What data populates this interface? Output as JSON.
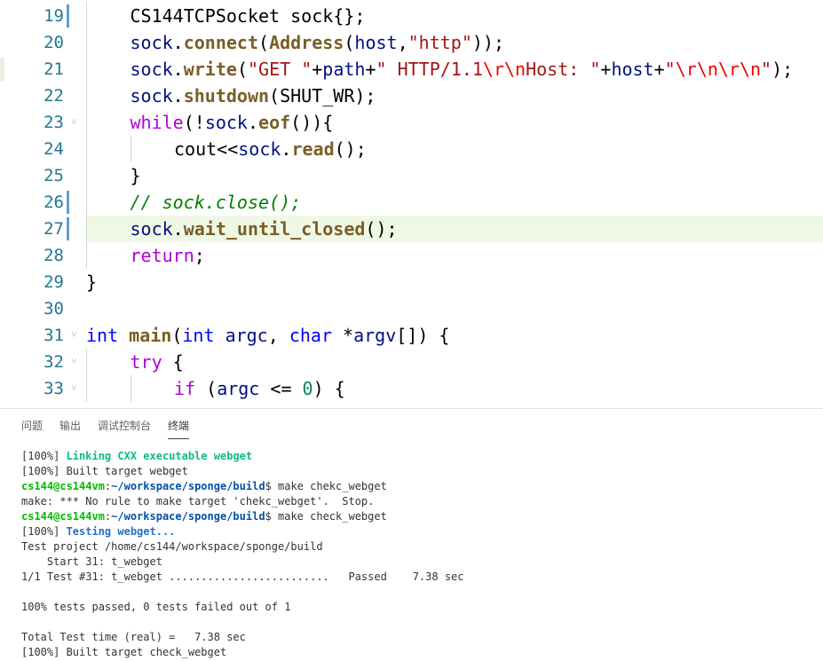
{
  "colors": {
    "line_number": "#237893",
    "change_marker": "#5f9ecf",
    "current_line_highlight": "#eef8e4",
    "keyword": "#0000ff",
    "control": "#af00db",
    "function": "#795e26",
    "string": "#a31515",
    "escape": "#ee0000",
    "variable": "#001080",
    "number": "#098658",
    "comment": "#008000",
    "term_green": "#0dbc79",
    "term_blue": "#2472c8",
    "prompt_green": "#00bc00",
    "prompt_blue": "#0451a5"
  },
  "editor": {
    "lines": [
      {
        "num": "19",
        "modified": true,
        "indent": 1,
        "tokens": [
          {
            "t": "CS144TCPSocket sock{};",
            "c": ""
          }
        ]
      },
      {
        "num": "20",
        "indent": 1,
        "tokens": [
          {
            "t": "sock",
            "c": "var"
          },
          {
            "t": ".",
            "c": ""
          },
          {
            "t": "connect",
            "c": "fn"
          },
          {
            "t": "(",
            "c": ""
          },
          {
            "t": "Address",
            "c": "fn"
          },
          {
            "t": "(",
            "c": ""
          },
          {
            "t": "host",
            "c": "var"
          },
          {
            "t": ",",
            "c": ""
          },
          {
            "t": "\"http\"",
            "c": "str"
          },
          {
            "t": "));",
            "c": ""
          }
        ]
      },
      {
        "num": "21",
        "edge": true,
        "indent": 1,
        "tokens": [
          {
            "t": "sock",
            "c": "var"
          },
          {
            "t": ".",
            "c": ""
          },
          {
            "t": "write",
            "c": "fn"
          },
          {
            "t": "(",
            "c": ""
          },
          {
            "t": "\"GET \"",
            "c": "str"
          },
          {
            "t": "+",
            "c": ""
          },
          {
            "t": "path",
            "c": "var"
          },
          {
            "t": "+",
            "c": ""
          },
          {
            "t": "\" HTTP/1.1",
            "c": "str"
          },
          {
            "t": "\\r\\n",
            "c": "esc"
          },
          {
            "t": "Host: \"",
            "c": "str"
          },
          {
            "t": "+",
            "c": ""
          },
          {
            "t": "host",
            "c": "var"
          },
          {
            "t": "+",
            "c": ""
          },
          {
            "t": "\"",
            "c": "str"
          },
          {
            "t": "\\r\\n\\r\\n",
            "c": "esc"
          },
          {
            "t": "\"",
            "c": "str"
          },
          {
            "t": ");",
            "c": ""
          }
        ]
      },
      {
        "num": "22",
        "indent": 1,
        "tokens": [
          {
            "t": "sock",
            "c": "var"
          },
          {
            "t": ".",
            "c": ""
          },
          {
            "t": "shutdown",
            "c": "fn"
          },
          {
            "t": "(SHUT_WR);",
            "c": ""
          }
        ]
      },
      {
        "num": "23",
        "fold": true,
        "indent": 1,
        "tokens": [
          {
            "t": "while",
            "c": "ctl"
          },
          {
            "t": "(!",
            "c": ""
          },
          {
            "t": "sock",
            "c": "var"
          },
          {
            "t": ".",
            "c": ""
          },
          {
            "t": "eof",
            "c": "fn"
          },
          {
            "t": "()){",
            "c": ""
          }
        ]
      },
      {
        "num": "24",
        "indent": 2,
        "tokens": [
          {
            "t": "cout<<",
            "c": ""
          },
          {
            "t": "sock",
            "c": "var"
          },
          {
            "t": ".",
            "c": ""
          },
          {
            "t": "read",
            "c": "fn"
          },
          {
            "t": "();",
            "c": ""
          }
        ]
      },
      {
        "num": "25",
        "indent": 1,
        "tokens": [
          {
            "t": "}",
            "c": ""
          }
        ]
      },
      {
        "num": "26",
        "modified": true,
        "indent": 1,
        "tokens": [
          {
            "t": "// sock.close();",
            "c": "com"
          }
        ]
      },
      {
        "num": "27",
        "modified": true,
        "highlight": true,
        "indent": 1,
        "tokens": [
          {
            "t": "sock",
            "c": "var"
          },
          {
            "t": ".",
            "c": ""
          },
          {
            "t": "wait_until_closed",
            "c": "fn"
          },
          {
            "t": "();",
            "c": ""
          }
        ]
      },
      {
        "num": "28",
        "indent": 1,
        "tokens": [
          {
            "t": "return",
            "c": "ctl"
          },
          {
            "t": ";",
            "c": ""
          }
        ]
      },
      {
        "num": "29",
        "indent": 0,
        "tokens": [
          {
            "t": "}",
            "c": ""
          }
        ]
      },
      {
        "num": "30",
        "indent": 0,
        "tokens": []
      },
      {
        "num": "31",
        "fold": true,
        "indent": 0,
        "tokens": [
          {
            "t": "int",
            "c": "kw"
          },
          {
            "t": " ",
            "c": ""
          },
          {
            "t": "main",
            "c": "fn"
          },
          {
            "t": "(",
            "c": ""
          },
          {
            "t": "int",
            "c": "kw"
          },
          {
            "t": " ",
            "c": ""
          },
          {
            "t": "argc",
            "c": "var"
          },
          {
            "t": ", ",
            "c": ""
          },
          {
            "t": "char",
            "c": "kw"
          },
          {
            "t": " *",
            "c": ""
          },
          {
            "t": "argv",
            "c": "var"
          },
          {
            "t": "[]) {",
            "c": ""
          }
        ]
      },
      {
        "num": "32",
        "fold": true,
        "indent": 1,
        "tokens": [
          {
            "t": "try",
            "c": "ctl"
          },
          {
            "t": " {",
            "c": ""
          }
        ]
      },
      {
        "num": "33",
        "fold": true,
        "indent": 2,
        "tokens": [
          {
            "t": "if",
            "c": "ctl"
          },
          {
            "t": " (",
            "c": ""
          },
          {
            "t": "argc",
            "c": "var"
          },
          {
            "t": " <= ",
            "c": ""
          },
          {
            "t": "0",
            "c": "num"
          },
          {
            "t": ") {",
            "c": ""
          }
        ]
      }
    ]
  },
  "panel": {
    "tabs": [
      {
        "label": "问题",
        "active": false
      },
      {
        "label": "输出",
        "active": false
      },
      {
        "label": "调试控制台",
        "active": false
      },
      {
        "label": "终端",
        "active": true
      }
    ],
    "terminal_lines": [
      [
        {
          "t": "[100%] ",
          "c": ""
        },
        {
          "t": "Linking CXX executable webget",
          "c": "green"
        }
      ],
      [
        {
          "t": "[100%] Built target webget",
          "c": ""
        }
      ],
      [
        {
          "t": "cs144@cs144vm",
          "c": "pgreen"
        },
        {
          "t": ":",
          "c": ""
        },
        {
          "t": "~/workspace/sponge/build",
          "c": "pblue"
        },
        {
          "t": "$ make chekc_webget",
          "c": ""
        }
      ],
      [
        {
          "t": "make: *** No rule to make target 'chekc_webget'.  Stop.",
          "c": ""
        }
      ],
      [
        {
          "t": "cs144@cs144vm",
          "c": "pgreen"
        },
        {
          "t": ":",
          "c": ""
        },
        {
          "t": "~/workspace/sponge/build",
          "c": "pblue"
        },
        {
          "t": "$ make check_webget",
          "c": ""
        }
      ],
      [
        {
          "t": "[100%] ",
          "c": ""
        },
        {
          "t": "Testing webget...",
          "c": "blue"
        }
      ],
      [
        {
          "t": "Test project /home/cs144/workspace/sponge/build",
          "c": ""
        }
      ],
      [
        {
          "t": "    Start 31: t_webget",
          "c": ""
        }
      ],
      [
        {
          "t": "1/1 Test #31: t_webget .........................   Passed    7.38 sec",
          "c": ""
        }
      ],
      [],
      [
        {
          "t": "100% tests passed, 0 tests failed out of 1",
          "c": ""
        }
      ],
      [],
      [
        {
          "t": "Total Test time (real) =   7.38 sec",
          "c": ""
        }
      ],
      [
        {
          "t": "[100%] Built target check_webget",
          "c": ""
        }
      ]
    ]
  }
}
